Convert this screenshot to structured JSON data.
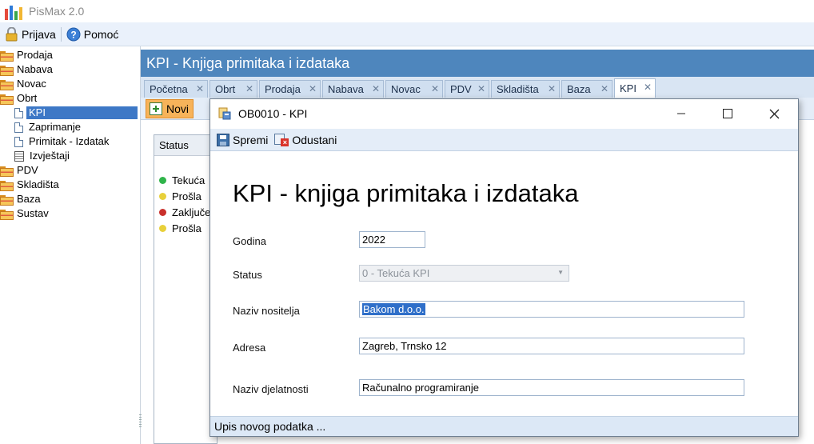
{
  "app": {
    "title": "PisMax 2.0",
    "brand_colors": [
      "#e64b3c",
      "#2e7bd8",
      "#3aa84a",
      "#f2b632"
    ]
  },
  "menu": {
    "prijava_label": "Prijava",
    "prijava_icon": "lock-icon",
    "pomoc_label": "Pomoć",
    "pomoc_icon": "help-icon"
  },
  "sidebar": {
    "items": [
      {
        "label": "Prodaja",
        "icon": "folder-icon"
      },
      {
        "label": "Nabava",
        "icon": "folder-icon"
      },
      {
        "label": "Novac",
        "icon": "folder-icon"
      },
      {
        "label": "Obrt",
        "icon": "folder-icon"
      },
      {
        "label": "KPI",
        "icon": "document-icon",
        "selected": true
      },
      {
        "label": "Zaprimanje",
        "icon": "document-icon"
      },
      {
        "label": "Primitak - Izdatak",
        "icon": "document-icon"
      },
      {
        "label": "Izvještaji",
        "icon": "report-icon"
      },
      {
        "label": "PDV",
        "icon": "folder-icon"
      },
      {
        "label": "Skladišta",
        "icon": "folder-icon"
      },
      {
        "label": "Baza",
        "icon": "folder-icon"
      },
      {
        "label": "Sustav",
        "icon": "folder-icon"
      }
    ]
  },
  "main": {
    "header_title": "KPI - Knjiga primitaka i izdataka",
    "tabs": [
      {
        "label": "Početna"
      },
      {
        "label": "Obrt"
      },
      {
        "label": "Prodaja"
      },
      {
        "label": "Nabava"
      },
      {
        "label": "Novac"
      },
      {
        "label": "PDV"
      },
      {
        "label": "Skladišta"
      },
      {
        "label": "Baza"
      },
      {
        "label": "KPI",
        "active": true
      }
    ],
    "tab_close_glyph": "✕",
    "toolbar": {
      "new_label": "Novi"
    },
    "status_column_header": "Status",
    "status_rows": [
      {
        "label": "Tekuća",
        "color": "#2fb44a"
      },
      {
        "label": "Prošla",
        "color": "#e8d03a"
      },
      {
        "label": "Zaključe",
        "color": "#c9302c"
      },
      {
        "label": "Prošla",
        "color": "#e8d03a"
      }
    ]
  },
  "dialog": {
    "title": "OB0010 - KPI",
    "toolbar": {
      "save_label": "Spremi",
      "cancel_label": "Odustani"
    },
    "form_title": "KPI - knjiga primitaka i izdataka",
    "fields": {
      "godina": {
        "label": "Godina",
        "value": "2022"
      },
      "status": {
        "label": "Status",
        "value": "0 - Tekuća KPI"
      },
      "naziv_nositelja": {
        "label": "Naziv nositelja",
        "value": "Bakom d.o.o."
      },
      "adresa": {
        "label": "Adresa",
        "value": "Zagreb, Trnsko 12"
      },
      "naziv_djelatnosti": {
        "label": "Naziv djelatnosti",
        "value": "Računalno programiranje"
      }
    },
    "status_bar": "Upis novog podatka ..."
  }
}
